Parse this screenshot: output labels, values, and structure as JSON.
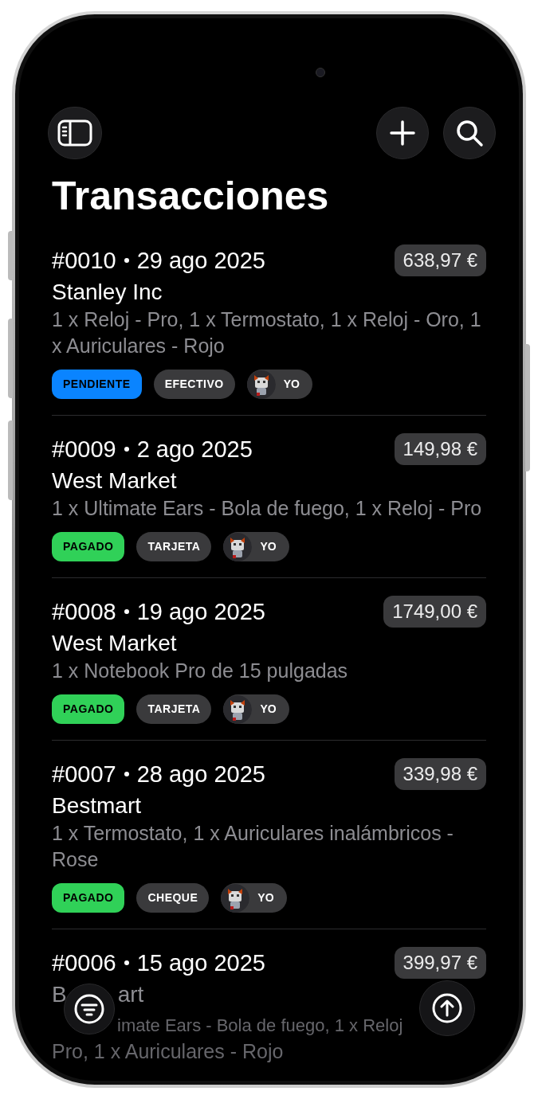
{
  "title": "Transacciones",
  "transactions": [
    {
      "number": "#0010",
      "date": "29 ago 2025",
      "amount": "638,97 €",
      "merchant": "Stanley Inc",
      "items": "1 x Reloj - Pro, 1 x Termostato, 1 x Reloj - Oro, 1 x Auriculares - Rojo",
      "status": {
        "label": "PENDIENTE",
        "color": "#0a84ff"
      },
      "method": "EFECTIVO",
      "owner": "YO"
    },
    {
      "number": "#0009",
      "date": "2 ago 2025",
      "amount": "149,98 €",
      "merchant": "West Market",
      "items": "1 x Ultimate Ears - Bola de fuego, 1 x Reloj - Pro",
      "status": {
        "label": "PAGADO",
        "color": "#30d158"
      },
      "method": "TARJETA",
      "owner": "YO"
    },
    {
      "number": "#0008",
      "date": "19 ago 2025",
      "amount": "1749,00 €",
      "merchant": "West Market",
      "items": "1 x Notebook Pro de 15 pulgadas",
      "status": {
        "label": "PAGADO",
        "color": "#30d158"
      },
      "method": "TARJETA",
      "owner": "YO"
    },
    {
      "number": "#0007",
      "date": "28 ago 2025",
      "amount": "339,98 €",
      "merchant": "Bestmart",
      "items": "1 x Termostato, 1 x Auriculares inalámbricos - Rose",
      "status": {
        "label": "PAGADO",
        "color": "#30d158"
      },
      "method": "CHEQUE",
      "owner": "YO"
    },
    {
      "number": "#0006",
      "date": "15 ago 2025",
      "amount": "399,97 €",
      "merchant_fragments": [
        "B",
        "art"
      ],
      "items_fragments": [
        "imate Ears - Bola de fuego, 1 x Reloj",
        "Pro, 1 x Auriculares - Rojo"
      ]
    }
  ]
}
